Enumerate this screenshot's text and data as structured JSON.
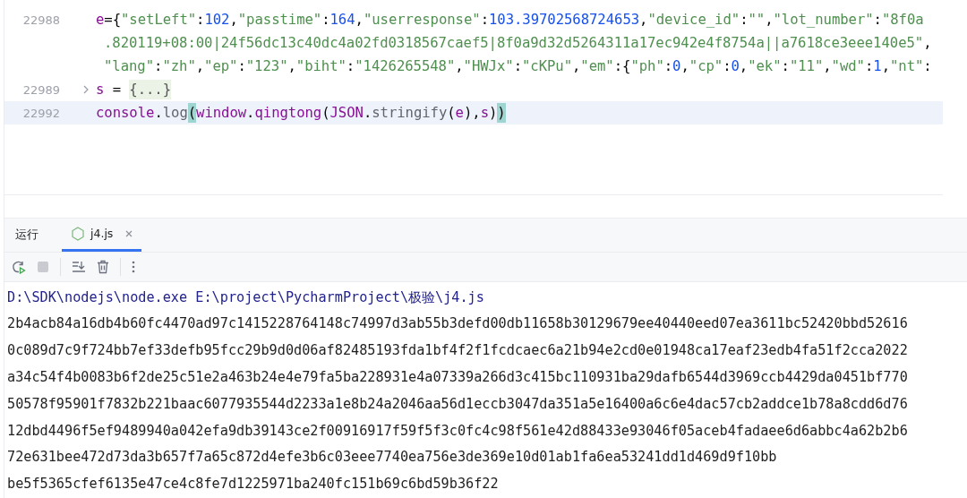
{
  "editor": {
    "lines": [
      {
        "number": "22988",
        "foldable": false,
        "current": false,
        "rows": [
          {
            "segments": [
              {
                "kind": "var",
                "text": "e"
              },
              {
                "kind": "punct",
                "text": "={"
              },
              {
                "kind": "str",
                "text": "\"setLeft\""
              },
              {
                "kind": "punct",
                "text": ":"
              },
              {
                "kind": "num",
                "text": "102"
              },
              {
                "kind": "punct",
                "text": ","
              },
              {
                "kind": "str",
                "text": "\"passtime\""
              },
              {
                "kind": "punct",
                "text": ":"
              },
              {
                "kind": "num",
                "text": "164"
              },
              {
                "kind": "punct",
                "text": ","
              },
              {
                "kind": "str",
                "text": "\"userresponse\""
              },
              {
                "kind": "punct",
                "text": ":"
              },
              {
                "kind": "num",
                "text": "103.39702568724653"
              },
              {
                "kind": "punct",
                "text": ","
              },
              {
                "kind": "str",
                "text": "\"device_id\""
              },
              {
                "kind": "punct",
                "text": ":"
              },
              {
                "kind": "str",
                "text": "\"\""
              },
              {
                "kind": "punct",
                "text": ","
              },
              {
                "kind": "str",
                "text": "\"lot_number\""
              },
              {
                "kind": "punct",
                "text": ":"
              },
              {
                "kind": "str",
                "text": "\"8f0a"
              }
            ]
          },
          {
            "segments": [
              {
                "kind": "str",
                "text": ".820119+08:00|24f56dc13c40dc4a02fd0318567caef5|8f0a9d32d5264311a17ec942e4f8754a||a7618ce3eee140e5\""
              },
              {
                "kind": "punct",
                "text": ","
              }
            ]
          },
          {
            "segments": [
              {
                "kind": "str",
                "text": "\"lang\""
              },
              {
                "kind": "punct",
                "text": ":"
              },
              {
                "kind": "str",
                "text": "\"zh\""
              },
              {
                "kind": "punct",
                "text": ","
              },
              {
                "kind": "str",
                "text": "\"ep\""
              },
              {
                "kind": "punct",
                "text": ":"
              },
              {
                "kind": "str",
                "text": "\"123\""
              },
              {
                "kind": "punct",
                "text": ","
              },
              {
                "kind": "str",
                "text": "\"biht\""
              },
              {
                "kind": "punct",
                "text": ":"
              },
              {
                "kind": "str",
                "text": "\"1426265548\""
              },
              {
                "kind": "punct",
                "text": ","
              },
              {
                "kind": "str",
                "text": "\"HWJx\""
              },
              {
                "kind": "punct",
                "text": ":"
              },
              {
                "kind": "str",
                "text": "\"cKPu\""
              },
              {
                "kind": "punct",
                "text": ","
              },
              {
                "kind": "str",
                "text": "\"em\""
              },
              {
                "kind": "punct",
                "text": ":{"
              },
              {
                "kind": "str",
                "text": "\"ph\""
              },
              {
                "kind": "punct",
                "text": ":"
              },
              {
                "kind": "num",
                "text": "0"
              },
              {
                "kind": "punct",
                "text": ","
              },
              {
                "kind": "str",
                "text": "\"cp\""
              },
              {
                "kind": "punct",
                "text": ":"
              },
              {
                "kind": "num",
                "text": "0"
              },
              {
                "kind": "punct",
                "text": ","
              },
              {
                "kind": "str",
                "text": "\"ek\""
              },
              {
                "kind": "punct",
                "text": ":"
              },
              {
                "kind": "str",
                "text": "\"11\""
              },
              {
                "kind": "punct",
                "text": ","
              },
              {
                "kind": "str",
                "text": "\"wd\""
              },
              {
                "kind": "punct",
                "text": ":"
              },
              {
                "kind": "num",
                "text": "1"
              },
              {
                "kind": "punct",
                "text": ","
              },
              {
                "kind": "str",
                "text": "\"nt\""
              },
              {
                "kind": "punct",
                "text": ":"
              }
            ]
          }
        ]
      },
      {
        "number": "22989",
        "foldable": true,
        "current": false,
        "rows": [
          {
            "segments": [
              {
                "kind": "var",
                "text": "s"
              },
              {
                "kind": "punct",
                "text": " = "
              },
              {
                "kind": "fold",
                "text": "{...}"
              }
            ]
          }
        ]
      },
      {
        "number": "22992",
        "foldable": false,
        "current": true,
        "rows": [
          {
            "segments": [
              {
                "kind": "var",
                "text": "console"
              },
              {
                "kind": "punct",
                "text": "."
              },
              {
                "kind": "method",
                "text": "log"
              },
              {
                "kind": "match",
                "text": "("
              },
              {
                "kind": "var",
                "text": "window"
              },
              {
                "kind": "punct",
                "text": "."
              },
              {
                "kind": "var",
                "text": "qingtong"
              },
              {
                "kind": "punct",
                "text": "("
              },
              {
                "kind": "var",
                "text": "JSON"
              },
              {
                "kind": "punct",
                "text": "."
              },
              {
                "kind": "method",
                "text": "stringify"
              },
              {
                "kind": "punct",
                "text": "("
              },
              {
                "kind": "var",
                "text": "e"
              },
              {
                "kind": "punct",
                "text": "),"
              },
              {
                "kind": "var",
                "text": "s"
              },
              {
                "kind": "punct",
                "text": ")"
              },
              {
                "kind": "match",
                "text": ")"
              }
            ]
          }
        ]
      }
    ]
  },
  "run_panel": {
    "title": "运行",
    "tabs": [
      {
        "label": "j4.js",
        "selected": true
      }
    ],
    "toolbar": [
      {
        "kind": "rerun",
        "disabled": false
      },
      {
        "kind": "stop",
        "disabled": true
      },
      {
        "kind": "separator"
      },
      {
        "kind": "scroll_end",
        "disabled": false
      },
      {
        "kind": "clear",
        "disabled": false
      },
      {
        "kind": "separator"
      },
      {
        "kind": "more",
        "disabled": false
      }
    ],
    "output": [
      {
        "kind": "command",
        "text": "D:\\SDK\\nodejs\\node.exe E:\\project\\PycharmProject\\极验\\j4.js"
      },
      {
        "kind": "stdout",
        "text": "2b4acb84a16db4b60fc4470ad97c1415228764148c74997d3ab55b3defd00db11658b30129679ee40440eed07ea3611bc52420bbd52616"
      },
      {
        "kind": "stdout",
        "text": "0c089d7c9f724bb7ef33defb95fcc29b9d0d06af82485193fda1bf4f2f1fcdcaec6a21b94e2cd0e01948ca17eaf23edb4fa51f2cca2022"
      },
      {
        "kind": "stdout",
        "text": "a34c54f4b0083b6f2de25c51e2a463b24e4e79fa5ba228931e4a07339a266d3c415bc110931ba29dafb6544d3969ccb4429da0451bf770"
      },
      {
        "kind": "stdout",
        "text": "50578f95901f7832b221baac6077935544d2233a1e8b24a2046aa56d1eccb3047da351a5e16400a6c6e4dac57cb2addce1b78a8cdd6d76"
      },
      {
        "kind": "stdout",
        "text": "12dbd4496f5ef9489940a042efa9db39143ce2f00916917f59f5f3c0fc4c98f561e42d88433e93046f05aceb4fadaee6d6abbc4a62b2b6"
      },
      {
        "kind": "stdout",
        "text": "72e631bee472d73da3b657f7a65c872d4efe3b6c03eee7740ea756e3de369e10d01ab1fa6ea53241dd1d469d9f10bb"
      },
      {
        "kind": "stdout",
        "text": "be5f5365cfef6135e47ce4c8fe7d1225971ba240fc151b69c6bd59b36f22"
      }
    ]
  }
}
